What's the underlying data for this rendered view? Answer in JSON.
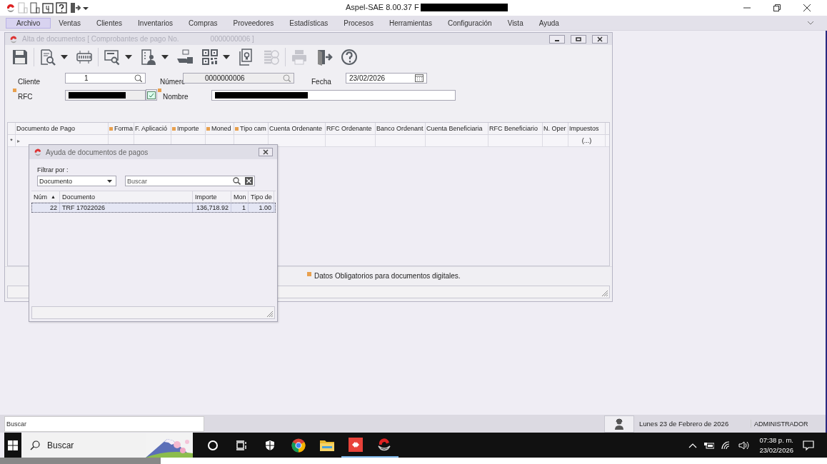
{
  "window": {
    "title": "Aspel-SAE 8.00.37 F",
    "title_redacted": true
  },
  "menu": [
    {
      "label": "Archivo",
      "selected": true
    },
    {
      "label": "Ventas",
      "selected": false
    },
    {
      "label": "Clientes",
      "selected": false
    },
    {
      "label": "Inventarios",
      "selected": false
    },
    {
      "label": "Compras",
      "selected": false
    },
    {
      "label": "Proveedores",
      "selected": false
    },
    {
      "label": "Estadísticas",
      "selected": false
    },
    {
      "label": "Procesos",
      "selected": false
    },
    {
      "label": "Herramientas",
      "selected": false
    },
    {
      "label": "Configuración",
      "selected": false
    },
    {
      "label": "Vista",
      "selected": false
    },
    {
      "label": "Ayuda",
      "selected": false
    }
  ],
  "document_window": {
    "title": "Alta de documentos [ Comprobantes de pago No.",
    "title_number": "0000000006 ]",
    "toolbar": [
      {
        "kind": "save",
        "disabled": false,
        "dropdown": false
      },
      {
        "kind": "preview",
        "disabled": false,
        "dropdown": true
      },
      {
        "kind": "counter",
        "disabled": false,
        "dropdown": false
      },
      {
        "kind": "screen-search",
        "disabled": false,
        "dropdown": true
      },
      {
        "kind": "person-doc",
        "disabled": false,
        "dropdown": true
      },
      {
        "kind": "money-hand",
        "disabled": false,
        "dropdown": false
      },
      {
        "kind": "qr",
        "disabled": false,
        "dropdown": true
      },
      {
        "kind": "certificate",
        "disabled": false,
        "dropdown": false
      },
      {
        "kind": "coins",
        "disabled": true,
        "dropdown": false
      },
      {
        "kind": "printer",
        "disabled": true,
        "dropdown": false
      },
      {
        "kind": "exit",
        "disabled": false,
        "dropdown": false
      },
      {
        "kind": "help",
        "disabled": false,
        "dropdown": false
      }
    ],
    "cliente": {
      "label": "Cliente",
      "value": "1"
    },
    "numero": {
      "label": "Número",
      "value": "0000000006"
    },
    "fecha": {
      "label": "Fecha",
      "value": "23/02/2026"
    },
    "rfc": {
      "label": "RFC",
      "required": true,
      "redacted": true
    },
    "nombre": {
      "label": "Nombre",
      "required": true,
      "redacted": true
    },
    "columns": [
      {
        "label": "Documento de Pago",
        "required": false
      },
      {
        "label": "Forma",
        "required": true
      },
      {
        "label": "F. Aplicació",
        "required": false
      },
      {
        "label": "Importe",
        "required": true
      },
      {
        "label": "Moned",
        "required": true
      },
      {
        "label": "Tipo cam",
        "required": true
      },
      {
        "label": "Cuenta Ordenante",
        "required": false
      },
      {
        "label": "RFC Ordenante",
        "required": false
      },
      {
        "label": "Banco Ordenant",
        "required": false
      },
      {
        "label": "Cuenta Beneficiaria",
        "required": false
      },
      {
        "label": "RFC Beneficiario",
        "required": false
      },
      {
        "label": "N. Oper",
        "required": false
      },
      {
        "label": "Impuestos",
        "required": false
      }
    ],
    "new_row": {
      "marker": "*",
      "pointer": "▸",
      "impuestos": "(...)"
    },
    "legend": "Datos Obligatorios para documentos digitales."
  },
  "help_dialog": {
    "title": "Ayuda de documentos de pagos",
    "filter_label": "Filtrar por :",
    "filter_value": "Documento",
    "search_placeholder": "Buscar",
    "columns": [
      "Núm",
      "Documento",
      "Importe",
      "Mon",
      "Tipo de"
    ],
    "sort_mark": "▲",
    "rows": [
      {
        "cells": [
          "22",
          "TRF 17022026",
          "136,718.92",
          "1",
          "1.00"
        ],
        "selected": true
      }
    ]
  },
  "status_bar": {
    "search_placeholder": "Buscar",
    "date": "Lunes 23 de Febrero de 2026",
    "user": "ADMINISTRADOR"
  },
  "taskbar": {
    "search_placeholder": "Buscar",
    "apps": [
      {
        "kind": "cortana",
        "active": false
      },
      {
        "kind": "taskview",
        "active": false
      },
      {
        "kind": "shield",
        "active": false
      },
      {
        "kind": "chrome",
        "active": false
      },
      {
        "kind": "folder",
        "active": false
      },
      {
        "kind": "shortcut",
        "active": true
      },
      {
        "kind": "aspel",
        "active": true
      }
    ],
    "time": "07:38 p. m.",
    "date": "23/02/2026"
  }
}
